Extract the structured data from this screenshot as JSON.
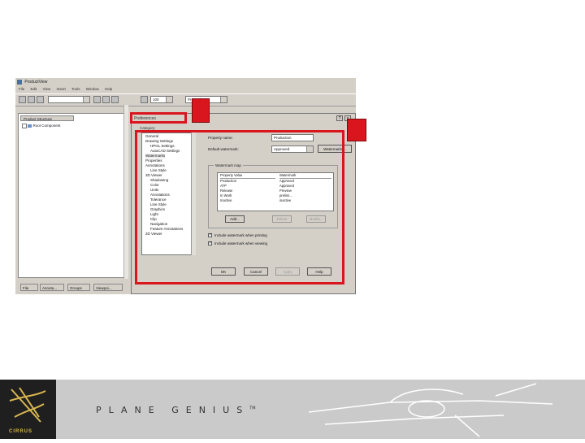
{
  "app": {
    "title": "ProductView",
    "menu": [
      "File",
      "Edit",
      "View",
      "Insert",
      "Tools",
      "Window",
      "Help"
    ]
  },
  "toolbar": {
    "combo1_value": "",
    "combo2_value": "Properties",
    "zoom_label": "100"
  },
  "left_pane": {
    "tab_label": "Product Structure",
    "tree_root": "Root Component",
    "bottom_tabs": [
      "File",
      "Annota...",
      "Groups",
      "Viewpoi..."
    ]
  },
  "dialog": {
    "title": "Preferences",
    "close_help": "?",
    "close_x": "x",
    "category_label": "Category:",
    "categories": [
      "General",
      "Drawing Settings",
      "HPGL Settings",
      "AutoCAD Settings",
      "Watermarks",
      "Properties",
      "Annotations",
      "Line Style",
      "3D Viewer",
      "Shadowing",
      "Color",
      "Units",
      "Annotations",
      "Tolerance",
      "Line Style",
      "Graphics",
      "Light",
      "Clip",
      "Navigation",
      "Feature Annotations",
      "2D Viewer"
    ],
    "property_name_label": "Property name:",
    "property_name_value": "Production",
    "default_watermark_label": "Default watermark:",
    "default_watermark_value": "Approved",
    "watermarks_button": "Watermarks...",
    "watermark_map_title": "Watermark map",
    "table_headers": [
      "Property Value",
      "Watermark"
    ],
    "table_rows": [
      [
        "Production",
        "Approved"
      ],
      [
        "ATP",
        "Approved"
      ],
      [
        "Release",
        "Preview"
      ],
      [
        "In Work",
        "prelimi..."
      ],
      [
        "Inactive",
        "inactive"
      ]
    ],
    "add_button": "Add...",
    "delete_button": "Delete",
    "modify_button": "Modify...",
    "include_print_label": "Include watermark when printing",
    "include_view_label": "Include watermark when viewing",
    "ok_button": "OK",
    "cancel_button": "Cancel",
    "apply_button": "Apply",
    "help_button": "Help"
  },
  "footer": {
    "logo_text": "CIRRUS",
    "tagline": "PLANE GENIUS",
    "trademark": "TM"
  },
  "colors": {
    "highlight_red": "#d9161e",
    "logo_gold": "#d7b650"
  }
}
